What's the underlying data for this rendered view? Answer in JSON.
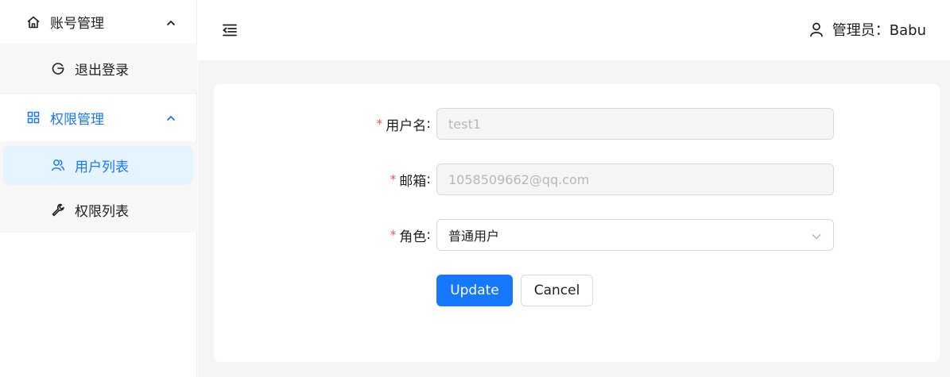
{
  "sidebar": {
    "account_menu": {
      "label": "账号管理",
      "icon": "home-icon",
      "expanded": true
    },
    "logout_item": {
      "label": "退出登录",
      "icon": "logout-icon"
    },
    "permission_menu": {
      "label": "权限管理",
      "icon": "appstore-icon",
      "expanded": true
    },
    "user_list_item": {
      "label": "用户列表",
      "icon": "users-icon",
      "active": true
    },
    "permission_list_item": {
      "label": "权限列表",
      "icon": "wrench-icon"
    }
  },
  "header": {
    "collapse_icon": "menu-fold-icon",
    "user_icon": "user-icon",
    "user_label": "管理员：Babu"
  },
  "form": {
    "username": {
      "label": "用户名",
      "value": "test1",
      "required": true,
      "disabled": true
    },
    "email": {
      "label": "邮箱",
      "value": "1058509662@qq.com",
      "required": true,
      "disabled": true
    },
    "role": {
      "label": "角色",
      "value": "普通用户",
      "required": true
    },
    "required_mark": "*",
    "colon": ":",
    "update_button": "Update",
    "cancel_button": "Cancel"
  },
  "colors": {
    "primary": "#1677ff",
    "active_bg": "#e6f4ff",
    "required": "#ff4d4f",
    "content_bg": "#f5f5f5"
  }
}
